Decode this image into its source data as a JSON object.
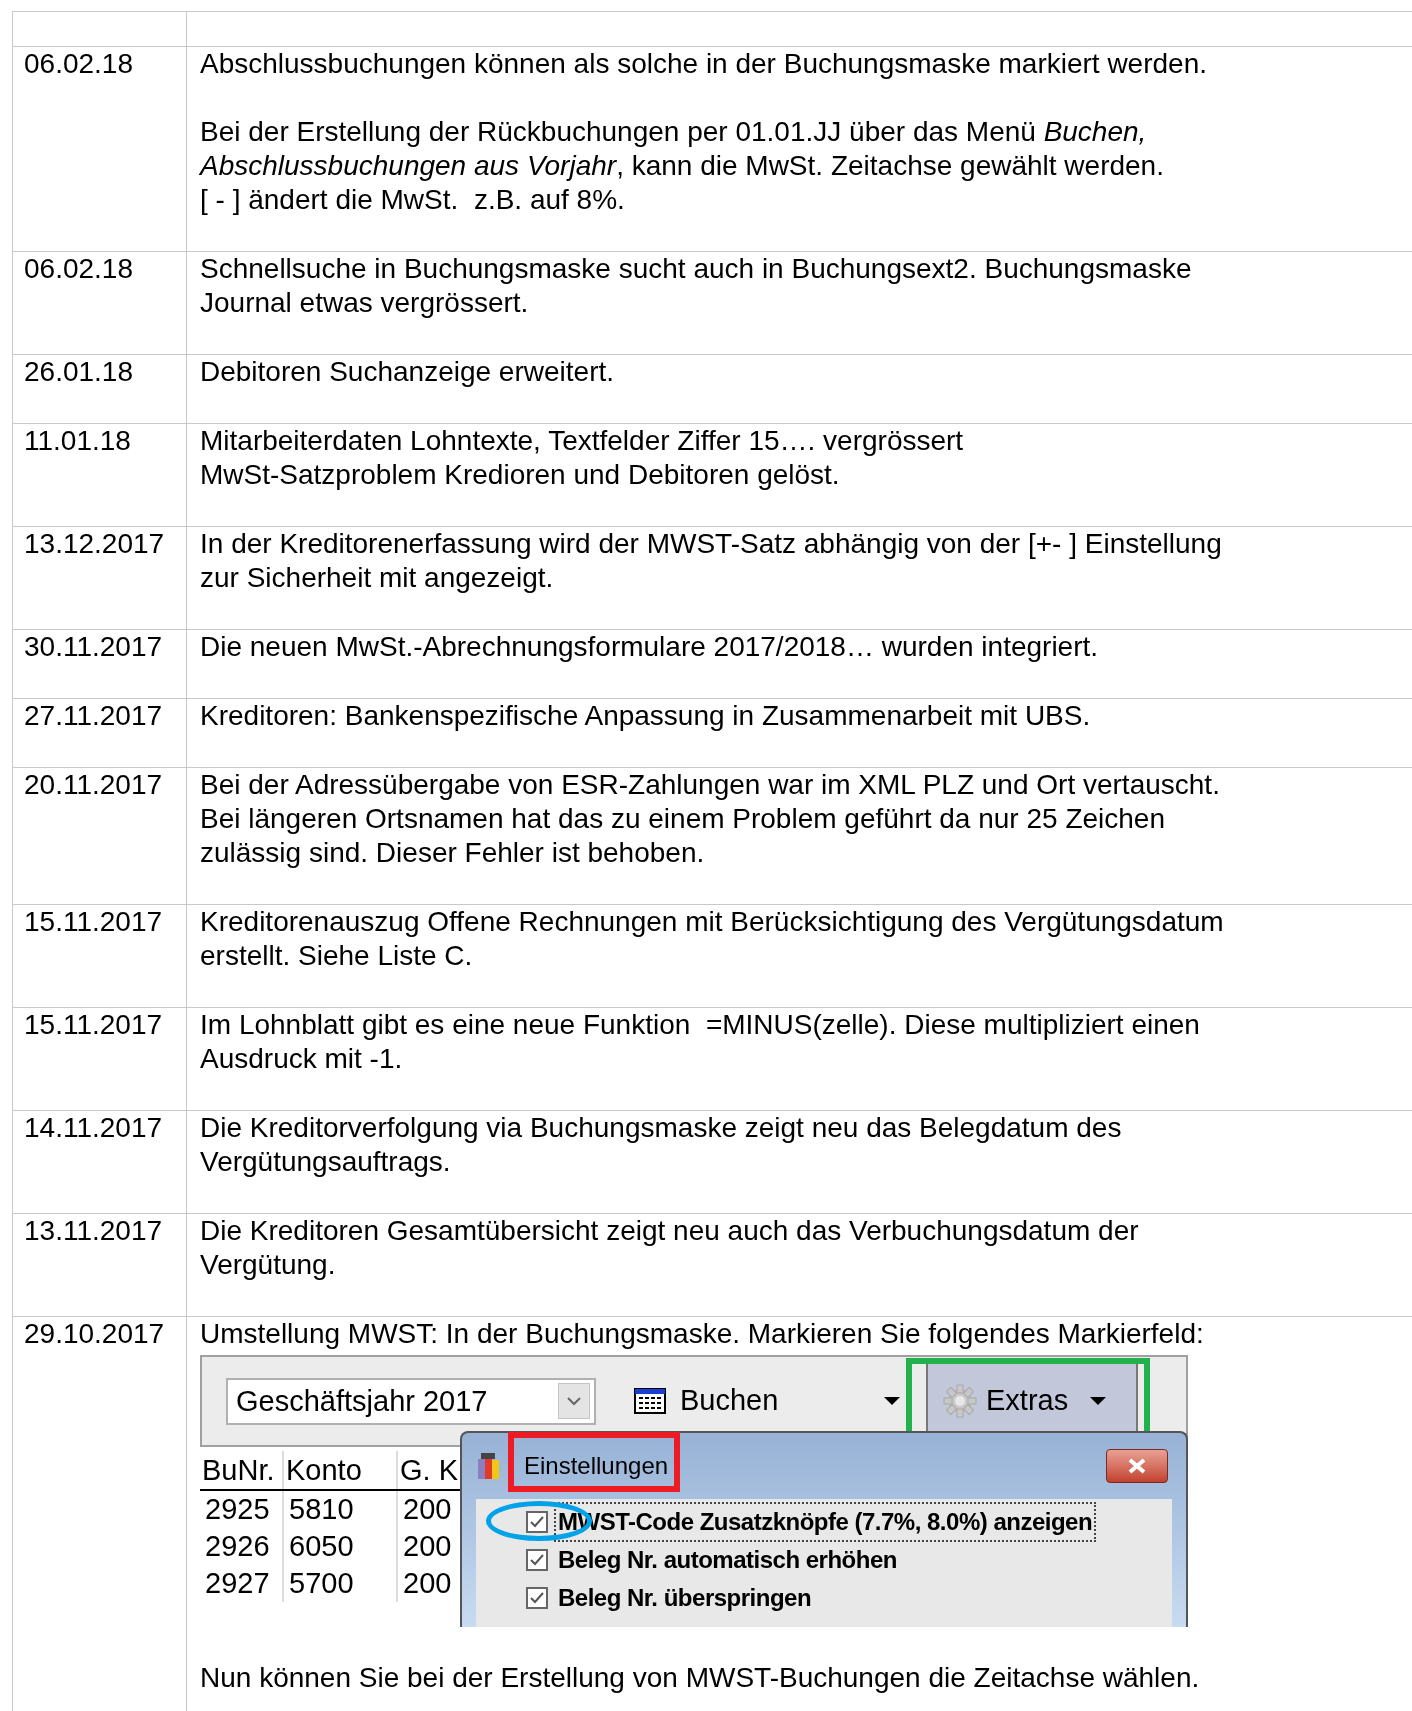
{
  "table": {
    "rows": [
      {
        "date": "06.02.18",
        "blocks": [
          {
            "kind": "text",
            "text": "Abschlussbuchungen können als solche in der Buchungsmaske markiert werden."
          },
          {
            "kind": "text",
            "text": "Bei der Erstellung der Rückbuchungen per 01.01.JJ über das Menü *Buchen,*\n*Abschlussbuchungen aus Vorjahr*, kann die MwSt. Zeitachse gewählt werden.\n[ - ] ändert die MwSt.  z.B. auf 8%."
          }
        ]
      },
      {
        "date": "06.02.18",
        "blocks": [
          {
            "kind": "text",
            "text": "Schnellsuche in Buchungsmaske sucht auch in Buchungsext2. Buchungsmaske\nJournal etwas vergrössert."
          }
        ]
      },
      {
        "date": "26.01.18",
        "blocks": [
          {
            "kind": "text",
            "text": "Debitoren Suchanzeige erweitert."
          }
        ]
      },
      {
        "date": "11.01.18",
        "blocks": [
          {
            "kind": "text",
            "text": "Mitarbeiterdaten Lohntexte, Textfelder Ziffer 15…. vergrössert\nMwSt-Satzproblem Kredioren und Debitoren gelöst."
          }
        ]
      },
      {
        "date": "13.12.2017",
        "blocks": [
          {
            "kind": "text",
            "text": "In der Kreditorenerfassung wird der MWST-Satz abhängig von der [+- ] Einstellung\nzur Sicherheit mit angezeigt."
          }
        ]
      },
      {
        "date": "30.11.2017",
        "blocks": [
          {
            "kind": "text",
            "text": "Die neuen MwSt.-Abrechnungsformulare 2017/2018… wurden integriert."
          }
        ]
      },
      {
        "date": "27.11.2017",
        "blocks": [
          {
            "kind": "text",
            "text": "Kreditoren: Bankenspezifische Anpassung in Zusammenarbeit mit UBS."
          }
        ]
      },
      {
        "date": "20.11.2017",
        "blocks": [
          {
            "kind": "text",
            "text": "Bei der Adressübergabe von ESR-Zahlungen war im XML PLZ und Ort vertauscht.\nBei längeren Ortsnamen hat das zu einem Problem geführt da nur 25 Zeichen\nzulässig sind. Dieser Fehler ist behoben."
          }
        ]
      },
      {
        "date": "15.11.2017",
        "blocks": [
          {
            "kind": "text",
            "text": "Kreditorenauszug Offene Rechnungen mit Berücksichtigung des Vergütungsdatum\nerstellt. Siehe Liste C."
          }
        ]
      },
      {
        "date": "15.11.2017",
        "blocks": [
          {
            "kind": "text",
            "text": "Im Lohnblatt gibt es eine neue Funktion  =MINUS(zelle). Diese multipliziert einen\nAusdruck mit -1."
          }
        ]
      },
      {
        "date": "14.11.2017",
        "blocks": [
          {
            "kind": "text",
            "text": "Die Kreditorverfolgung via Buchungsmaske zeigt neu das Belegdatum des\nVergütungsauftrags."
          }
        ]
      },
      {
        "date": "13.11.2017",
        "blocks": [
          {
            "kind": "text",
            "text": "Die Kreditoren Gesamtübersicht zeigt neu auch das Verbuchungsdatum der\nVergütung."
          }
        ]
      },
      {
        "date": "29.10.2017",
        "blocks": [
          {
            "kind": "text",
            "text": "Umstellung MWST: In der Buchungsmaske. Markieren Sie folgendes Markierfeld:"
          },
          {
            "kind": "screenshot",
            "combo": {
              "value": "Geschäftsjahr 2017"
            },
            "menus": [
              {
                "label": "Buchen",
                "kind": "menu"
              },
              {
                "label": "Extras",
                "kind": "button",
                "highlight": {
                  "color": "#22b14c"
                }
              }
            ],
            "grid": {
              "columns": [
                "BuNr.",
                "Konto",
                "G. K"
              ],
              "rows": [
                [
                  "2925",
                  "5810",
                  "200"
                ],
                [
                  "2926",
                  "6050",
                  "200"
                ],
                [
                  "2927",
                  "5700",
                  "200"
                ]
              ]
            },
            "dialog": {
              "title": "Einstellungen",
              "title_highlight": {
                "color": "#ed1c24"
              },
              "options": [
                {
                  "label": "MWST-Code Zusatzknöpfe (7.7%, 8.0%) anzeigen",
                  "checked": true,
                  "focused": true,
                  "highlight": {
                    "color": "#00a2e8"
                  }
                },
                {
                  "label": "Beleg Nr. automatisch erhöhen",
                  "checked": true,
                  "focused": false
                },
                {
                  "label": "Beleg Nr. überspringen",
                  "checked": true,
                  "focused": false
                }
              ]
            }
          },
          {
            "kind": "text",
            "text": "Nun können Sie bei der Erstellung von MWST-Buchungen die Zeitachse wählen."
          }
        ]
      }
    ]
  }
}
